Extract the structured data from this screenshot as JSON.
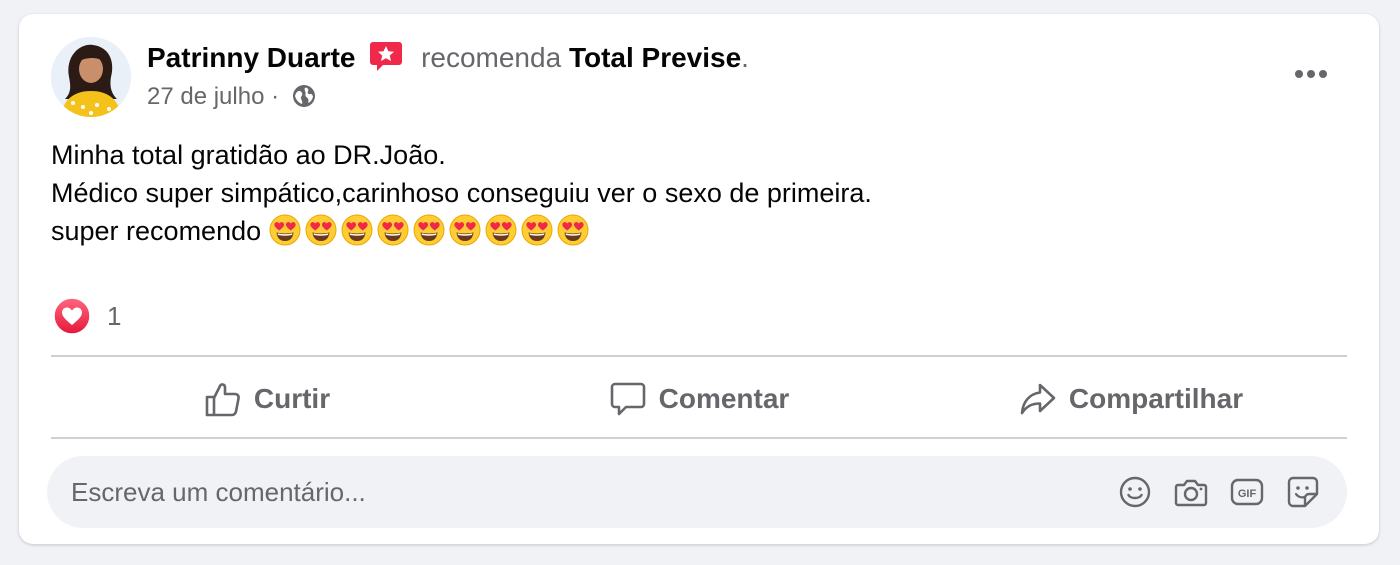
{
  "post": {
    "author": "Patrinny Duarte",
    "verb": "recomenda",
    "page": "Total Previse",
    "period": ".",
    "date": "27 de julho",
    "separator": "·",
    "audience_icon": "globe-icon",
    "body_lines": [
      "Minha total gratidão ao DR.João.",
      "Médico super simpático,carinhoso conseguiu ver o sexo de primeira.",
      "super recomendo"
    ],
    "emoji_name": "smiling-face-with-heart-eyes-icon",
    "emoji_count": 9
  },
  "reactions": {
    "icon": "love-reaction-icon",
    "count": "1"
  },
  "actions": {
    "like_label": "Curtir",
    "comment_label": "Comentar",
    "share_label": "Compartilhar"
  },
  "comment_box": {
    "placeholder": "Escreva um comentário...",
    "value": "",
    "icons": [
      "emoji-icon",
      "camera-icon",
      "gif-icon",
      "sticker-icon"
    ]
  },
  "colors": {
    "background": "#f0f2f5",
    "card": "#ffffff",
    "primary_text": "#050505",
    "secondary_text": "#65676b",
    "divider": "#ced0d4",
    "love": "#f33e58",
    "recommend_badge": "#f0284a"
  }
}
